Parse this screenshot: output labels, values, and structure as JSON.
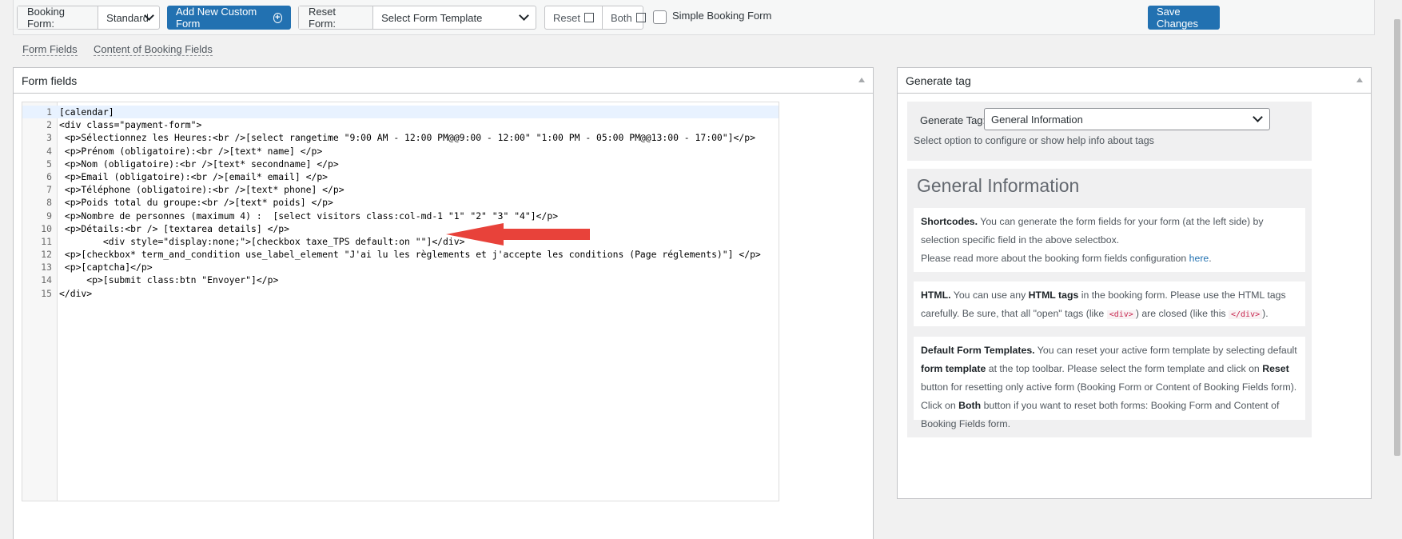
{
  "toolbar": {
    "booking_form_label": "Booking Form:",
    "booking_form_value": "Standard",
    "add_button": "Add New Custom Form",
    "reset_form_label": "Reset Form:",
    "reset_form_value": "Select Form Template",
    "reset_button": "Reset",
    "both_button": "Both",
    "simple_label": "Simple Booking Form",
    "save_button": "Save Changes"
  },
  "subtabs": [
    "Form Fields",
    "Content of Booking Fields"
  ],
  "form_panel": {
    "title": "Form fields",
    "code": [
      "[calendar]",
      "<div class=\"payment-form\">",
      " <p>Sélectionnez les Heures:<br />[select rangetime \"9:00 AM - 12:00 PM@@9:00 - 12:00\" \"1:00 PM - 05:00 PM@@13:00 - 17:00\"]</p>",
      " <p>Prénom (obligatoire):<br />[text* name] </p>",
      " <p>Nom (obligatoire):<br />[text* secondname] </p>",
      " <p>Email (obligatoire):<br />[email* email] </p>",
      " <p>Téléphone (obligatoire):<br />[text* phone] </p>",
      " <p>Poids total du groupe:<br />[text* poids] </p>",
      " <p>Nombre de personnes (maximum 4) :  [select visitors class:col-md-1 \"1\" \"2\" \"3\" \"4\"]</p>",
      " <p>Détails:<br /> [textarea details] </p>",
      "        <div style=\"display:none;\">[checkbox taxe_TPS default:on \"\"]</div>",
      " <p>[checkbox* term_and_condition use_label_element \"J'ai lu les règlements et j'accepte les conditions (Page réglements)\"] </p>",
      " <p>[captcha]</p>",
      "     <p>[submit class:btn \"Envoyer\"]</p>",
      "</div>"
    ]
  },
  "tag_panel": {
    "title": "Generate tag",
    "generate_label": "Generate Tag:",
    "generate_value": "General Information",
    "help": "Select option to configure or show help info about tags",
    "info_title": "General Information",
    "cards": {
      "shortcodes_title": "Shortcodes.",
      "shortcodes_text": " You can generate the form fields for your form (at the left side) by selection specific field in the above selectbox.",
      "shortcodes_more": "Please read more about the booking form fields configuration ",
      "shortcodes_link": "here",
      "html_title": "HTML.",
      "html_text1": " You can use any ",
      "html_bold": "HTML tags",
      "html_text2": " in the booking form. Please use the HTML tags carefully. Be sure, that all \"open\" tags (like ",
      "html_code1": "<div>",
      "html_text3": ") are closed (like this ",
      "html_code2": "</div>",
      "html_text4": ").",
      "templates_title": "Default Form Templates.",
      "templates_text1": " You can reset your active form template by selecting default ",
      "templates_bold1": "form template",
      "templates_text2": " at the top toolbar. Please select the form template and click on ",
      "templates_bold2": "Reset",
      "templates_text3": " button for resetting only active form (Booking Form or Content of Booking Fields form). Click on ",
      "templates_bold3": "Both",
      "templates_text4": " button if you want to reset both forms: Booking Form and Content of Booking Fields form."
    }
  }
}
